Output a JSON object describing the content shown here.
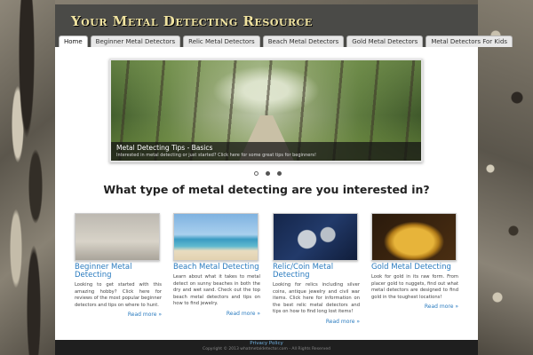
{
  "site": {
    "title": "Your Metal Detecting Resource"
  },
  "nav": {
    "items": [
      {
        "label": "Home"
      },
      {
        "label": "Beginner Metal Detectors"
      },
      {
        "label": "Relic Metal Detectors"
      },
      {
        "label": "Beach Metal Detectors"
      },
      {
        "label": "Gold Metal Detectors"
      },
      {
        "label": "Metal Detectors For Kids"
      }
    ],
    "active": "Home"
  },
  "slider": {
    "title": "Metal Detecting Tips - Basics",
    "text": "Interested in metal detecting or just started? Click here for some great tips for beginners!"
  },
  "question": "What type of metal detecting are you interested in?",
  "cards": [
    {
      "title": "Beginner Metal Detecting",
      "text": "Looking to get started with this amazing hobby? Click here for reviews of the most popular beginner detectors and tips on where to hunt.",
      "more": "Read more »"
    },
    {
      "title": "Beach Metal Detecting",
      "text": "Learn about what it takes to metal detect on sunny beaches in both the dry and wet sand. Check out the top beach metal detectors and tips on how to find jewelry.",
      "more": "Read more »"
    },
    {
      "title": "Relic/Coin Metal Detecting",
      "text": "Looking for relics including silver coins, antique jewelry and civil war items. Click here for information on the best relic metal detectors and tips on how to find long lost items!",
      "more": "Read more »"
    },
    {
      "title": "Gold Metal Detecting",
      "text": "Look for gold in its raw form. From placer gold to nuggets, find out what metal detectors are designed to find gold in the toughest locations!",
      "more": "Read more »"
    }
  ],
  "footer": {
    "link": "Privacy Policy",
    "copyright": "Copyright © 2013 whatmetaldetector.com - All Rights Reserved"
  }
}
